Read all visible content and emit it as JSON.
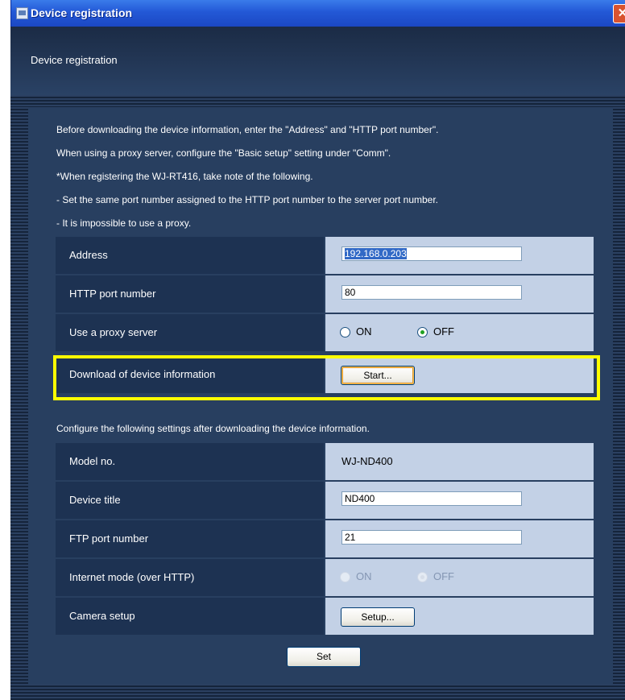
{
  "window": {
    "title": "Device registration",
    "close_glyph": "✕"
  },
  "header": {
    "text": "Device registration"
  },
  "instructions": [
    "Before downloading the device information, enter the \"Address\" and \"HTTP port number\".",
    "When using a proxy server, configure the \"Basic setup\" setting under \"Comm\".",
    "*When registering the WJ-RT416, take note of the following.",
    " - Set the same port number assigned to the HTTP port number to the server port number.",
    " - It is impossible to use a proxy."
  ],
  "download_section": {
    "address": {
      "label": "Address",
      "value": "192.168.0.203"
    },
    "http_port": {
      "label": "HTTP port number",
      "value": "80"
    },
    "proxy": {
      "label": "Use a proxy server",
      "on": "ON",
      "off": "OFF",
      "selected": "OFF"
    },
    "download": {
      "label": "Download of device information",
      "button": "Start..."
    }
  },
  "configure_note": "Configure the following settings after downloading the device information.",
  "configure_section": {
    "model": {
      "label": "Model no.",
      "value": "WJ-ND400"
    },
    "device_title": {
      "label": "Device title",
      "value": "ND400"
    },
    "ftp_port": {
      "label": "FTP port number",
      "value": "21"
    },
    "internet_mode": {
      "label": "Internet mode (over HTTP)",
      "on": "ON",
      "off": "OFF",
      "selected": "OFF",
      "disabled": true
    },
    "camera_setup": {
      "label": "Camera setup",
      "button": "Setup..."
    }
  },
  "set_button": "Set",
  "colors": {
    "highlight": "#ffff00",
    "title_bar": "#2358d6",
    "panel": "#283f60",
    "row_label": "#1d3252",
    "row_value": "#c3d1e6"
  },
  "icons": [
    "app-window-icon",
    "close-icon"
  ]
}
